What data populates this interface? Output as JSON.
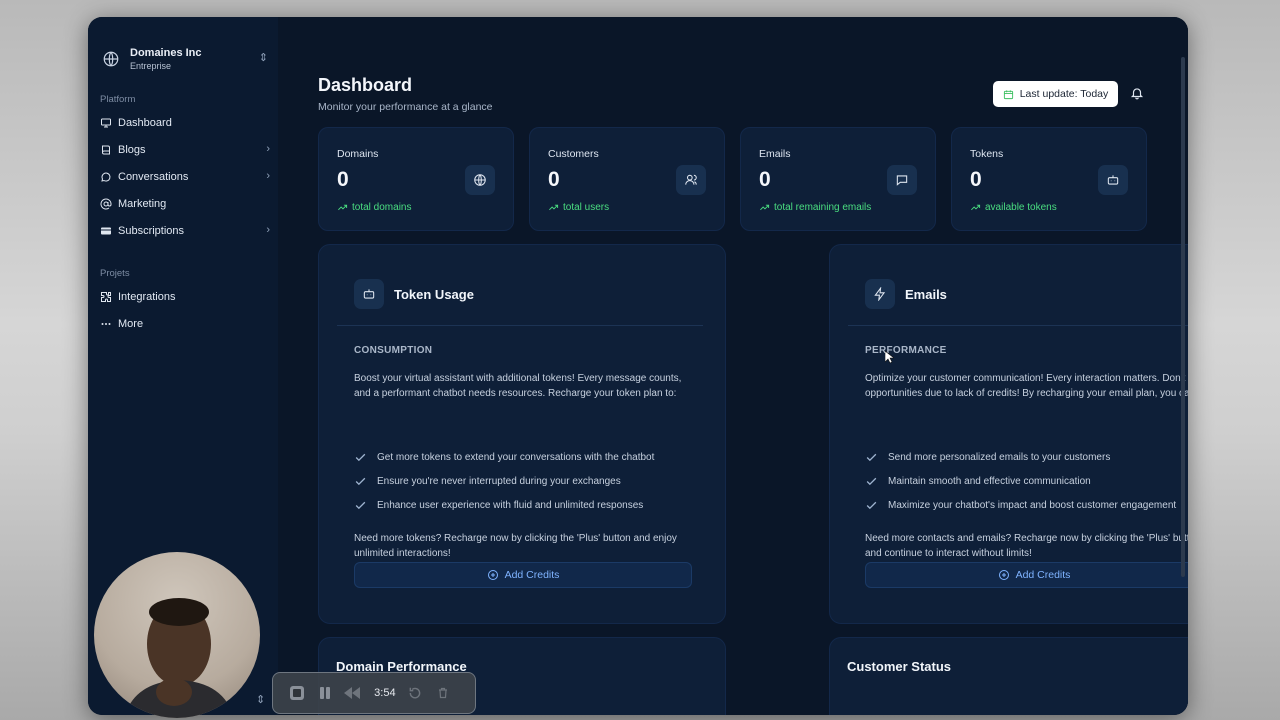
{
  "org": {
    "name": "Domaines Inc",
    "plan": "Entreprise"
  },
  "sidebar": {
    "platform_label": "Platform",
    "projects_label": "Projets",
    "items": [
      {
        "label": "Dashboard",
        "icon": "monitor-icon"
      },
      {
        "label": "Blogs",
        "icon": "book-icon"
      },
      {
        "label": "Conversations",
        "icon": "chat-icon"
      },
      {
        "label": "Marketing",
        "icon": "at-icon"
      },
      {
        "label": "Subscriptions",
        "icon": "credit-card-icon"
      },
      {
        "label": "Integrations",
        "icon": "puzzle-icon"
      },
      {
        "label": "More",
        "icon": "dots-icon"
      }
    ]
  },
  "header": {
    "title": "Dashboard",
    "subtitle": "Monitor your performance at a glance",
    "last_update": "Last update: Today"
  },
  "stats": [
    {
      "label": "Domains",
      "value": "0",
      "trend": "total domains",
      "icon": "globe-icon"
    },
    {
      "label": "Customers",
      "value": "0",
      "trend": "total users",
      "icon": "users-icon"
    },
    {
      "label": "Emails",
      "value": "0",
      "trend": "total remaining emails",
      "icon": "message-icon"
    },
    {
      "label": "Tokens",
      "value": "0",
      "trend": "available tokens",
      "icon": "bot-icon"
    }
  ],
  "token_panel": {
    "title": "Token Usage",
    "eyebrow": "CONSUMPTION",
    "description": "Boost your virtual assistant with additional tokens! Every message counts, and a performant chatbot needs resources. Recharge your token plan to:",
    "items": [
      "Get more tokens to extend your conversations with the chatbot",
      "Ensure you're never interrupted during your exchanges",
      "Enhance user experience with fluid and unlimited responses"
    ],
    "note": "Need more tokens? Recharge now by clicking the 'Plus' button and enjoy unlimited interactions!",
    "button": "Add Credits"
  },
  "email_panel": {
    "title": "Emails",
    "eyebrow": "PERFORMANCE",
    "description": "Optimize your customer communication! Every interaction matters. Don't miss opportunities due to lack of credits! By recharging your email plan, you can:",
    "items": [
      "Send more personalized emails to your customers",
      "Maintain smooth and effective communication",
      "Maximize your chatbot's impact and boost customer engagement"
    ],
    "note": "Need more contacts and emails? Recharge now by clicking the 'Plus' button and continue to interact without limits!",
    "button": "Add Credits"
  },
  "bottom": {
    "left_title": "Domain Performance",
    "right_title": "Customer Status"
  },
  "recorder": {
    "time": "3:54"
  },
  "colors": {
    "accent": "#7fb3ff",
    "trend": "#4ade80",
    "background": "#0a1628",
    "card": "#0e1f38"
  }
}
